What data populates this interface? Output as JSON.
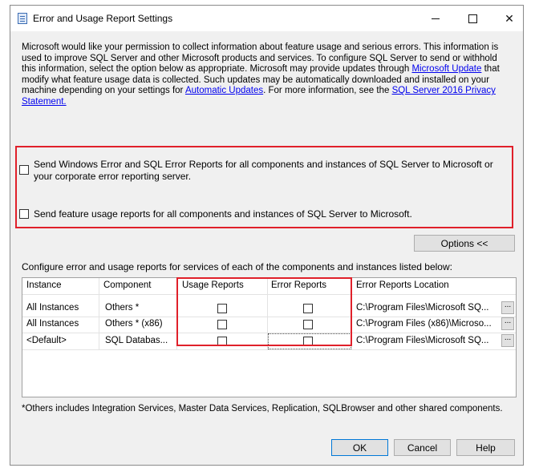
{
  "window": {
    "title": "Error and Usage Report Settings"
  },
  "description": {
    "p1": "Microsoft would like your permission to collect information about feature usage and serious errors. This information is used to improve SQL Server and other Microsoft products and services.  To configure SQL Server to send or withhold this information, select the option below as appropriate. Microsoft may provide updates through ",
    "link1": "Microsoft Update",
    "p2": " that modify what feature usage data is collected.  Such updates may be automatically downloaded and installed on your machine depending on your settings for ",
    "link2": "Automatic Updates",
    "p3": ". For more information, see the ",
    "link3": "SQL Server 2016 Privacy Statement.",
    "p4": ""
  },
  "options": {
    "error_reports_label": "Send Windows Error and SQL Error Reports for all components and instances of SQL Server to Microsoft or your corporate error reporting server.",
    "usage_reports_label": "Send feature usage reports for all components and instances of SQL Server to Microsoft.",
    "toggle_button": "Options <<"
  },
  "grid": {
    "caption": "Configure error and usage reports for services of each of the components and instances listed below:",
    "headers": {
      "instance": "Instance",
      "component": "Component",
      "usage": "Usage Reports",
      "error": "Error Reports",
      "location": "Error Reports Location"
    },
    "rows": [
      {
        "instance": "All Instances",
        "component": "Others *",
        "location": "C:\\Program Files\\Microsoft SQ..."
      },
      {
        "instance": "All Instances",
        "component": "Others * (x86)",
        "location": "C:\\Program Files (x86)\\Microso..."
      },
      {
        "instance": "<Default>",
        "component": "SQL Databas...",
        "location": "C:\\Program Files\\Microsoft SQ..."
      }
    ],
    "browse_label": "..."
  },
  "footnote": "*Others includes Integration Services, Master Data Services, Replication, SQLBrowser and other shared components.",
  "buttons": {
    "ok": "OK",
    "cancel": "Cancel",
    "help": "Help"
  },
  "colors": {
    "highlight": "#e0202a",
    "link": "#0000ee"
  }
}
